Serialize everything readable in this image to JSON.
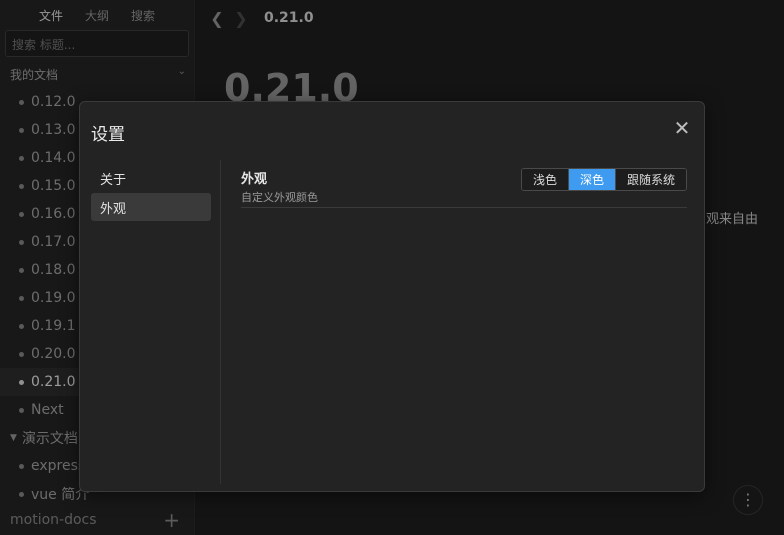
{
  "sidebar": {
    "tabs": [
      {
        "label": "文件"
      },
      {
        "label": "大纲"
      },
      {
        "label": "搜索"
      }
    ],
    "search_placeholder": "搜索 标题...",
    "tree_header": "我的文档",
    "items": [
      {
        "label": "0.12.0"
      },
      {
        "label": "0.13.0"
      },
      {
        "label": "0.14.0"
      },
      {
        "label": "0.15.0"
      },
      {
        "label": "0.16.0"
      },
      {
        "label": "0.17.0"
      },
      {
        "label": "0.18.0"
      },
      {
        "label": "0.19.0"
      },
      {
        "label": "0.19.1"
      },
      {
        "label": "0.20.0"
      },
      {
        "label": "0.21.0"
      },
      {
        "label": "Next"
      }
    ],
    "group_label": "演示文档",
    "group_items": [
      {
        "label": "express"
      },
      {
        "label": "vue 简介"
      }
    ],
    "footer_label": "motion-docs",
    "add_icon": "plus-icon"
  },
  "topbar": {
    "breadcrumb": "0.21.0",
    "back_icon": "chevron-left-icon",
    "forward_icon": "chevron-right-icon"
  },
  "document": {
    "title": "0.21.0",
    "snippet": "观来自由"
  },
  "dialog": {
    "title": "设置",
    "close_icon": "close-icon",
    "nav": [
      {
        "label": "关于"
      },
      {
        "label": "外观"
      }
    ],
    "setting": {
      "name": "外观",
      "description": "自定义外观颜色",
      "options": [
        {
          "label": "浅色"
        },
        {
          "label": "深色"
        },
        {
          "label": "跟随系统"
        }
      ],
      "selected": "深色"
    }
  },
  "colors": {
    "accent": "#3f9bef",
    "background": "#1f1f1f",
    "sidebar": "#252525",
    "dialog": "#232323"
  }
}
